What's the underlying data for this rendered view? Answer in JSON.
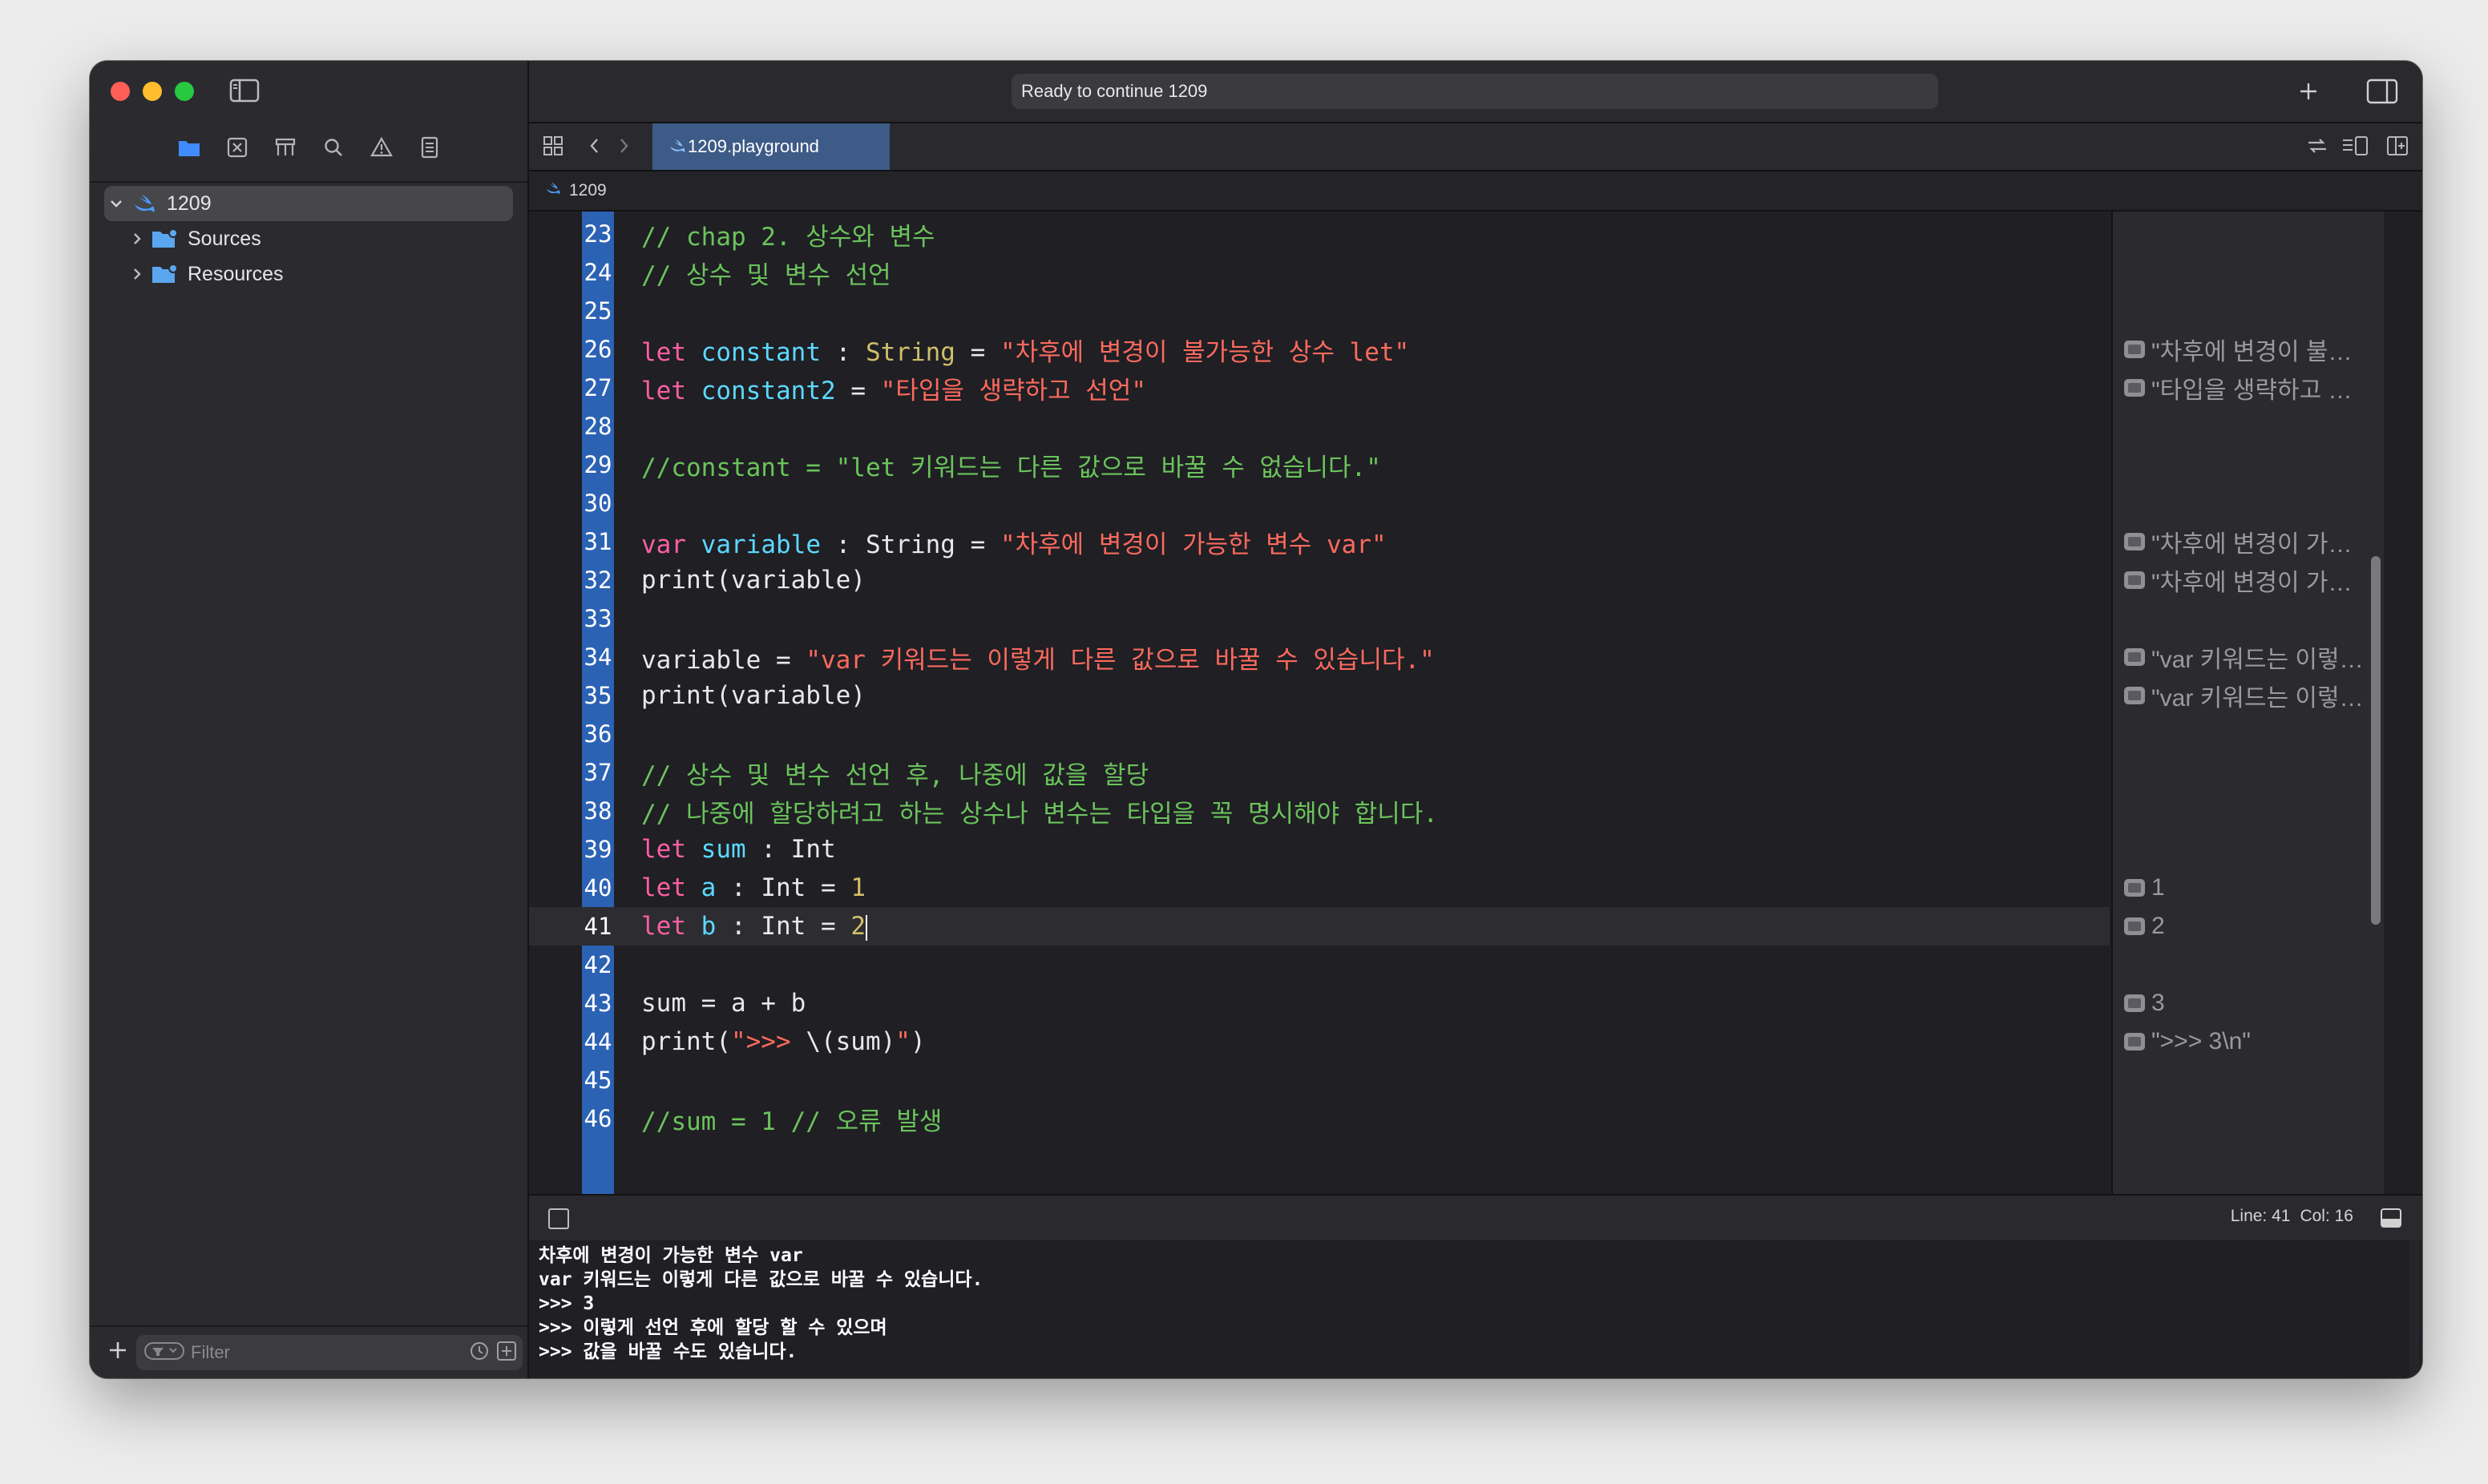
{
  "window": {
    "status": "Ready to continue 1209"
  },
  "sidebar": {
    "tree": [
      {
        "label": "1209",
        "level": 0,
        "expanded": true,
        "selected": true,
        "icon": "swift-icon"
      },
      {
        "label": "Sources",
        "level": 1,
        "expanded": false,
        "icon": "folder-icon"
      },
      {
        "label": "Resources",
        "level": 1,
        "expanded": false,
        "icon": "folder-icon"
      }
    ],
    "filter_placeholder": "Filter"
  },
  "tabs": {
    "active_label": "1209.playground"
  },
  "jumpbar": {
    "crumb": "1209"
  },
  "editor": {
    "current_line": 41,
    "lines": [
      {
        "n": "23",
        "tokens": [
          {
            "t": "// chap 2. 상수와 변수",
            "c": "cm"
          }
        ]
      },
      {
        "n": "24",
        "tokens": [
          {
            "t": "// 상수 및 변수 선언",
            "c": "cm"
          }
        ]
      },
      {
        "n": "25",
        "tokens": []
      },
      {
        "n": "26",
        "tokens": [
          {
            "t": "let",
            "c": "kw"
          },
          {
            "t": " ",
            "c": "plain"
          },
          {
            "t": "constant",
            "c": "idn"
          },
          {
            "t": " : ",
            "c": "plain"
          },
          {
            "t": "String",
            "c": "ty"
          },
          {
            "t": " = ",
            "c": "plain"
          },
          {
            "t": "\"차후에 변경이 불가능한 상수 let\"",
            "c": "str"
          }
        ]
      },
      {
        "n": "27",
        "tokens": [
          {
            "t": "let",
            "c": "kw"
          },
          {
            "t": " ",
            "c": "plain"
          },
          {
            "t": "constant2",
            "c": "idn"
          },
          {
            "t": " = ",
            "c": "plain"
          },
          {
            "t": "\"타입을 생략하고 선언\"",
            "c": "str"
          }
        ]
      },
      {
        "n": "28",
        "tokens": []
      },
      {
        "n": "29",
        "tokens": [
          {
            "t": "//constant = \"let 키워드는 다른 값으로 바꿀 수 없습니다.\"",
            "c": "cm"
          }
        ]
      },
      {
        "n": "30",
        "tokens": []
      },
      {
        "n": "31",
        "tokens": [
          {
            "t": "var",
            "c": "kw"
          },
          {
            "t": " ",
            "c": "plain"
          },
          {
            "t": "variable",
            "c": "idn"
          },
          {
            "t": " : String = ",
            "c": "plain"
          },
          {
            "t": "\"차후에 변경이 가능한 변수 var\"",
            "c": "str"
          }
        ]
      },
      {
        "n": "32",
        "tokens": [
          {
            "t": "print(variable)",
            "c": "plain"
          }
        ]
      },
      {
        "n": "33",
        "tokens": []
      },
      {
        "n": "34",
        "tokens": [
          {
            "t": "variable = ",
            "c": "plain"
          },
          {
            "t": "\"var 키워드는 이렇게 다른 값으로 바꿀 수 있습니다.\"",
            "c": "str"
          }
        ]
      },
      {
        "n": "35",
        "tokens": [
          {
            "t": "print(variable)",
            "c": "plain"
          }
        ]
      },
      {
        "n": "36",
        "tokens": []
      },
      {
        "n": "37",
        "tokens": [
          {
            "t": "// 상수 및 변수 선언 후, 나중에 값을 할당",
            "c": "cm"
          }
        ]
      },
      {
        "n": "38",
        "tokens": [
          {
            "t": "// 나중에 할당하려고 하는 상수나 변수는 타입을 꼭 명시해야 합니다.",
            "c": "cm"
          }
        ]
      },
      {
        "n": "39",
        "tokens": [
          {
            "t": "let",
            "c": "kw"
          },
          {
            "t": " ",
            "c": "plain"
          },
          {
            "t": "sum",
            "c": "idn"
          },
          {
            "t": " : Int",
            "c": "plain"
          }
        ]
      },
      {
        "n": "40",
        "tokens": [
          {
            "t": "let",
            "c": "kw"
          },
          {
            "t": " ",
            "c": "plain"
          },
          {
            "t": "a",
            "c": "idn"
          },
          {
            "t": " : Int = ",
            "c": "plain"
          },
          {
            "t": "1",
            "c": "num"
          }
        ]
      },
      {
        "n": "41",
        "tokens": [
          {
            "t": "let",
            "c": "kw"
          },
          {
            "t": " ",
            "c": "plain"
          },
          {
            "t": "b",
            "c": "idn"
          },
          {
            "t": " : Int = ",
            "c": "plain"
          },
          {
            "t": "2",
            "c": "num"
          }
        ]
      },
      {
        "n": "42",
        "tokens": []
      },
      {
        "n": "43",
        "tokens": [
          {
            "t": "sum = a + b",
            "c": "plain"
          }
        ]
      },
      {
        "n": "44",
        "tokens": [
          {
            "t": "print(",
            "c": "plain"
          },
          {
            "t": "\">>> ",
            "c": "str"
          },
          {
            "t": "\\(sum)",
            "c": "plain"
          },
          {
            "t": "\"",
            "c": "str"
          },
          {
            "t": ")",
            "c": "plain"
          }
        ]
      },
      {
        "n": "45",
        "tokens": []
      },
      {
        "n": "46",
        "tokens": [
          {
            "t": "//sum = 1 // 오류 발생",
            "c": "cm"
          }
        ]
      }
    ]
  },
  "results": [
    {
      "line": 3,
      "text": "\"차후에 변경이 불가능한 상수 let\""
    },
    {
      "line": 4,
      "text": "\"타입을 생략하고 선언\""
    },
    {
      "line": 8,
      "text": "\"차후에 변경이 가능한 변수 var\""
    },
    {
      "line": 9,
      "text": "\"차후에 변경이 가능한 변수 var\\n\""
    },
    {
      "line": 11,
      "text": "\"var 키워드는 이렇게 다른 값으로 바꿀 수 있습니다.\""
    },
    {
      "line": 12,
      "text": "\"var 키워드는 이렇게 다른 값으로 바꿀 수 있습니다.\\n\""
    },
    {
      "line": 17,
      "text": "1"
    },
    {
      "line": 18,
      "text": "2"
    },
    {
      "line": 20,
      "text": "3"
    },
    {
      "line": 21,
      "text": "\">>> 3\\n\""
    }
  ],
  "debug": {
    "line": "Line: 41",
    "col": "Col: 16"
  },
  "console": [
    "차후에 변경이 가능한 변수 var",
    "var 키워드는 이렇게 다른 값으로 바꿀 수 있습니다.",
    ">>> 3",
    ">>> 이렇게 선언 후에 할당 할 수 있으며",
    ">>> 값을 바꿀 수도 있습니다."
  ]
}
